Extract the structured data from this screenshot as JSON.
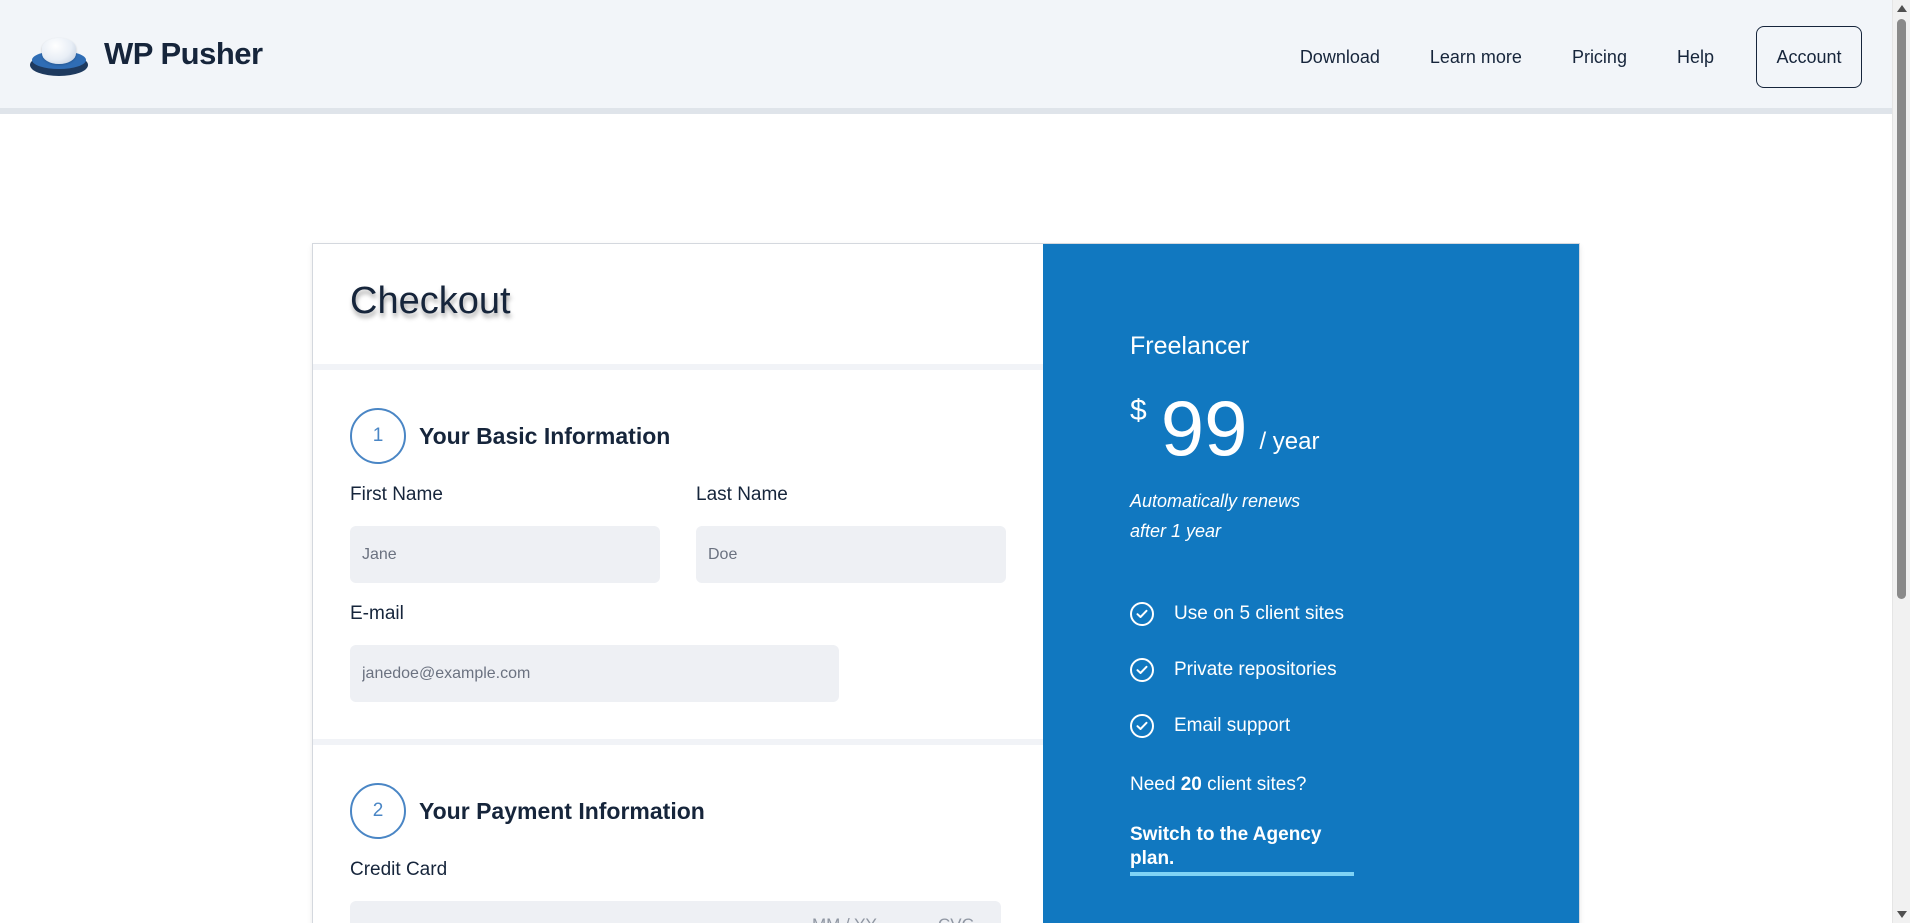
{
  "brand": {
    "name": "WP Pusher",
    "logo_icon": "hat-logo-icon"
  },
  "nav": {
    "links": [
      "Download",
      "Learn more",
      "Pricing",
      "Help"
    ],
    "account_label": "Account"
  },
  "checkout": {
    "title": "Checkout",
    "step1": {
      "number": "1",
      "title": "Your Basic Information",
      "first_name_label": "First Name",
      "first_name_placeholder": "Jane",
      "last_name_label": "Last Name",
      "last_name_placeholder": "Doe",
      "email_label": "E-mail",
      "email_placeholder": "janedoe@example.com"
    },
    "step2": {
      "number": "2",
      "title": "Your Payment Information",
      "credit_card_label": "Credit Card",
      "expiry_placeholder": "MM / YY",
      "cvc_placeholder": "CVC"
    }
  },
  "plan": {
    "name": "Freelancer",
    "currency": "$",
    "amount": "99",
    "period": "/ year",
    "renew_note": "Automatically renews after 1 year",
    "features": [
      "Use on 5 client sites",
      "Private repositories",
      "Email support"
    ],
    "upsell_prefix": "Need ",
    "upsell_count": "20",
    "upsell_suffix": " client sites?",
    "switch_label": "Switch to the Agency plan."
  },
  "colors": {
    "accent_blue": "#1178c0",
    "link_underline": "#7fd3f5",
    "step_circle": "#4a86c5",
    "text_dark": "#16253b"
  }
}
